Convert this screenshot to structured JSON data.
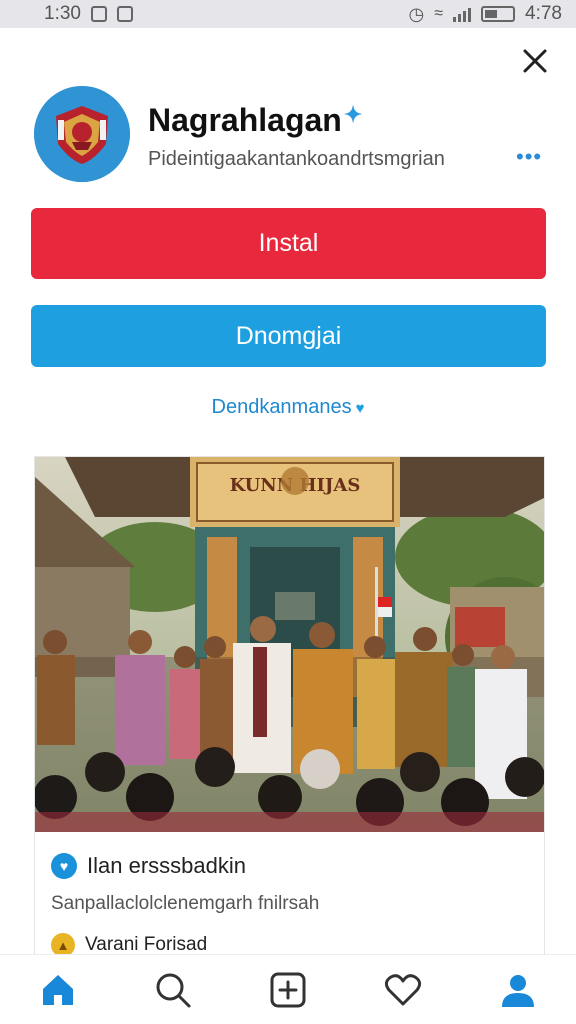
{
  "status_bar": {
    "time": "1:30",
    "battery_text": "4:78"
  },
  "app": {
    "title": "Nagrahlagan",
    "title_mark": "✦",
    "subtitle": "Pideintigaakantankoandrtsmgrian",
    "more_label": "•••",
    "icon": "emblem-icon"
  },
  "actions": {
    "install_label": "Instal",
    "secondary_label": "Dnomgjai",
    "more_link_label": "Dendkanmanes",
    "more_link_icon": "♥"
  },
  "card": {
    "image_sign": "KUNN HIJAS",
    "rows": [
      {
        "icon": "verified-icon",
        "text": "Ilan ersssbadkin"
      },
      {
        "text": "Sanpallaclolclenemgarh fnilrsah"
      },
      {
        "icon": "award-icon",
        "text": "Varani Forisad"
      }
    ]
  },
  "bottom_nav": [
    "home-icon",
    "search-icon",
    "add-icon",
    "heart-icon",
    "profile-icon"
  ],
  "colors": {
    "install": "#e8283c",
    "secondary": "#1ea0e0",
    "accent": "#2a8cd8",
    "nav_icon": "#1a88d8"
  }
}
